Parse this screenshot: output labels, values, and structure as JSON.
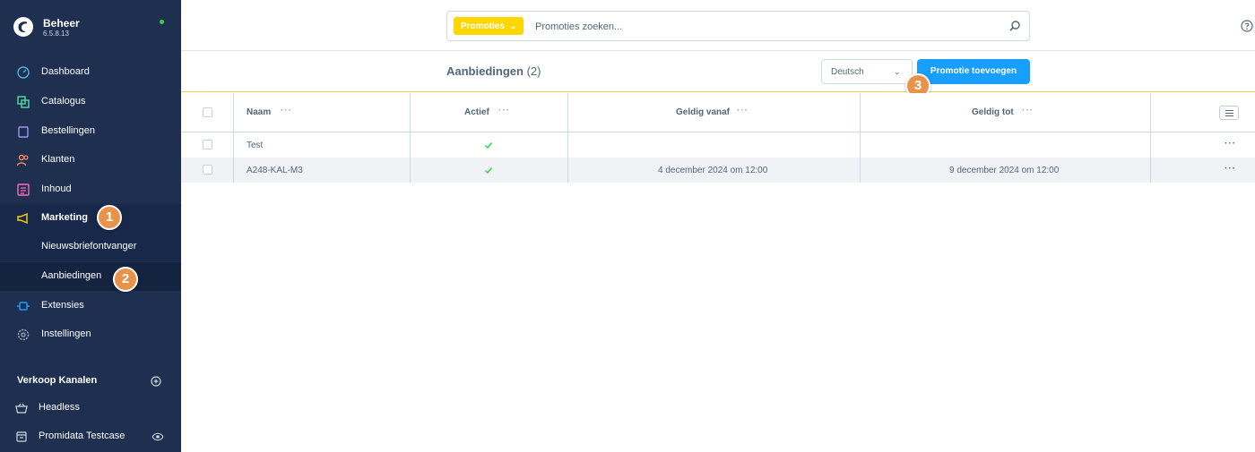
{
  "brand": {
    "name": "Beheer",
    "version": "6.5.8.13"
  },
  "nav": {
    "dashboard": "Dashboard",
    "catalogus": "Catalogus",
    "bestellingen": "Bestellingen",
    "klanten": "Klanten",
    "inhoud": "Inhoud",
    "marketing": "Marketing",
    "nieuwsbrief": "Nieuwsbriefontvanger",
    "aanbiedingen": "Aanbiedingen",
    "extensies": "Extensies",
    "instellingen": "Instellingen"
  },
  "sales_channels": {
    "title": "Verkoop Kanalen",
    "items": [
      "Headless",
      "Promidata Testcase"
    ]
  },
  "badges": [
    "1",
    "2",
    "3"
  ],
  "search": {
    "type_label": "Promoties",
    "placeholder": "Promoties zoeken..."
  },
  "smartbar": {
    "title": "Aanbiedingen",
    "count": "(2)",
    "language": "Deutsch",
    "add_button": "Promotie toevoegen"
  },
  "table": {
    "columns": [
      "Naam",
      "Actief",
      "Geldig vanaf",
      "Geldig tot"
    ],
    "column_menu": "···",
    "row_menu": "···",
    "rows": [
      {
        "naam": "Test",
        "actief": true,
        "geldig_vanaf": "",
        "geldig_tot": ""
      },
      {
        "naam": "A248-KAL-M3",
        "actief": true,
        "geldig_vanaf": "4 december 2024 om 12:00",
        "geldig_tot": "9 december 2024 om 12:00"
      }
    ]
  },
  "colors": {
    "sidebar": "#1e2f4f",
    "accent_yellow": "#ffd700",
    "primary": "#189eff",
    "badge": "#e8924a",
    "check": "#37d046"
  },
  "icons": {
    "dashboard": "gauge-icon",
    "catalogus": "products-icon",
    "bestellingen": "bag-icon",
    "klanten": "users-icon",
    "inhoud": "content-icon",
    "marketing": "megaphone-icon",
    "extensies": "plug-icon",
    "instellingen": "gear-icon"
  }
}
